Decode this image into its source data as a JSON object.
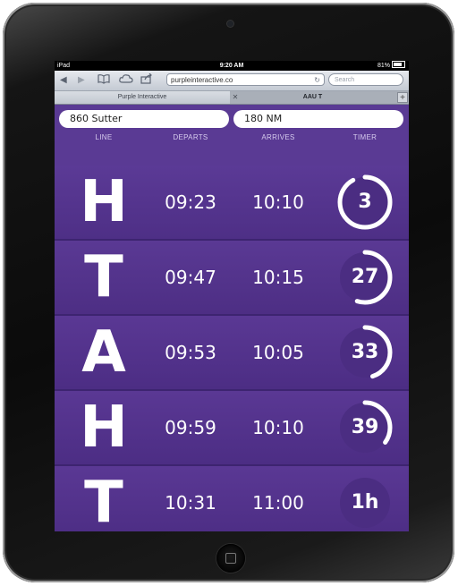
{
  "status": {
    "carrier": "iPad",
    "time": "9:20 AM",
    "battery": "81%"
  },
  "browser": {
    "url": "purpleinteractive.co",
    "search_placeholder": "Search"
  },
  "tabs": [
    {
      "label": "Purple Interactive",
      "active": true
    },
    {
      "label": "AAU T",
      "active": false
    }
  ],
  "fields": {
    "origin": "860 Sutter",
    "destination": "180 NM"
  },
  "headers": {
    "line": "LINE",
    "departs": "DEPARTS",
    "arrives": "ARRIVES",
    "timer": "TIMER"
  },
  "colors": {
    "background": "#5a3a94",
    "timer_track": "#4b2d82",
    "text": "#ffffff"
  },
  "schedule": [
    {
      "line": "H",
      "departs": "09:23",
      "arrives": "10:10",
      "timer": "3",
      "progress": 0.92
    },
    {
      "line": "T",
      "departs": "09:47",
      "arrives": "10:15",
      "timer": "27",
      "progress": 0.55
    },
    {
      "line": "A",
      "departs": "09:53",
      "arrives": "10:05",
      "timer": "33",
      "progress": 0.45
    },
    {
      "line": "H",
      "departs": "09:59",
      "arrives": "10:10",
      "timer": "39",
      "progress": 0.35
    },
    {
      "line": "T",
      "departs": "10:31",
      "arrives": "11:00",
      "timer": "1h",
      "progress": 0.0
    }
  ]
}
